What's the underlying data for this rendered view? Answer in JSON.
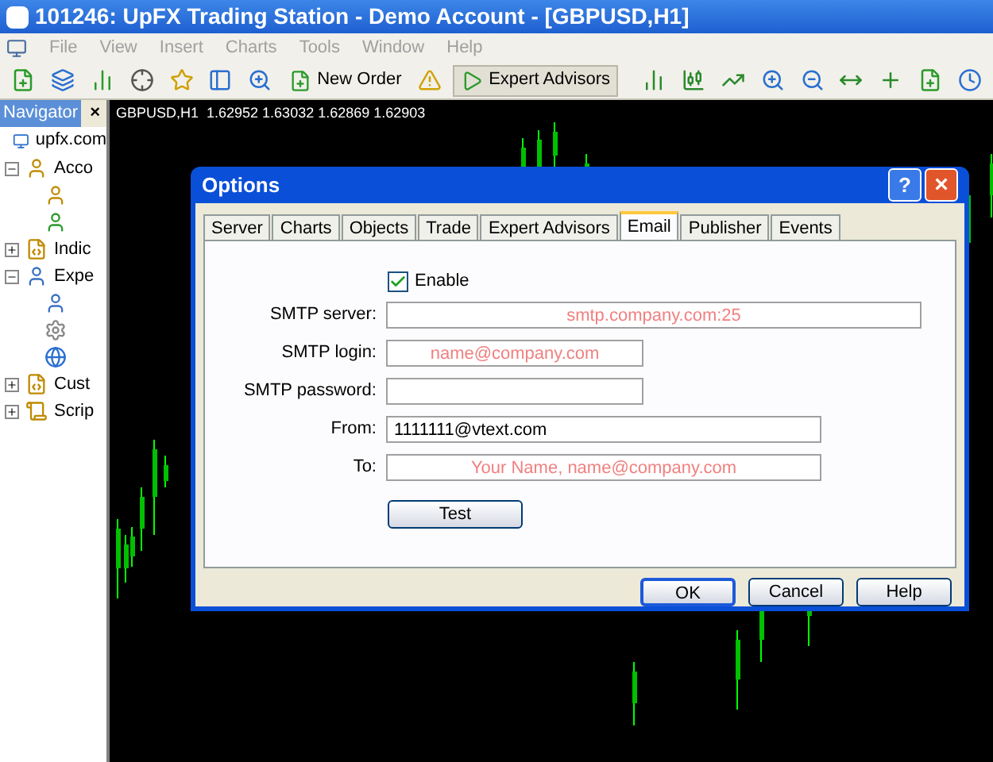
{
  "window": {
    "title": "101246: UpFX Trading Station - Demo Account - [GBPUSD,H1]"
  },
  "menu": [
    {
      "label": "File",
      "disabled": true
    },
    {
      "label": "View",
      "disabled": true
    },
    {
      "label": "Insert",
      "disabled": true
    },
    {
      "label": "Charts",
      "disabled": true
    },
    {
      "label": "Tools",
      "disabled": true
    },
    {
      "label": "Window",
      "disabled": true
    },
    {
      "label": "Help",
      "disabled": true
    }
  ],
  "toolbar": {
    "new_order": "New Order",
    "expert_advisors": {
      "label": "Expert Advisors",
      "selected": true
    }
  },
  "navigator": {
    "title": "Navigator",
    "close": "×",
    "root": "upfx.com",
    "items": [
      {
        "label": "Acco",
        "kind": "accounts",
        "expanded": true,
        "children": [
          {
            "kind": "account"
          },
          {
            "kind": "account-green"
          }
        ]
      },
      {
        "label": "Indic",
        "kind": "indicators",
        "expanded": false
      },
      {
        "label": "Expe",
        "kind": "experts",
        "expanded": true,
        "children": [
          {
            "kind": "expert"
          },
          {
            "kind": "gears"
          },
          {
            "kind": "globe"
          }
        ]
      },
      {
        "label": "Cust",
        "kind": "custom",
        "expanded": false
      },
      {
        "label": "Scrip",
        "kind": "scripts",
        "expanded": false
      }
    ]
  },
  "chart": {
    "header": "GBPUSD,H1  1.62952 1.63032 1.62869 1.62903"
  },
  "dialog": {
    "title": "Options",
    "help": "?",
    "close": "×",
    "tabs": [
      {
        "label": "Server",
        "selected": false
      },
      {
        "label": "Charts",
        "selected": false
      },
      {
        "label": "Objects",
        "selected": false
      },
      {
        "label": "Trade",
        "selected": false
      },
      {
        "label": "Expert Advisors",
        "selected": false
      },
      {
        "label": "Email",
        "selected": true
      },
      {
        "label": "Publisher",
        "selected": false
      },
      {
        "label": "Events",
        "selected": false
      }
    ],
    "enable": {
      "label": "Enable",
      "checked": true
    },
    "fields": [
      {
        "label": "SMTP server:",
        "placeholder": "smtp.company.com:25"
      },
      {
        "label": "SMTP login:",
        "placeholder": "name@company.com"
      },
      {
        "label": "SMTP password:"
      },
      {
        "label": "From:",
        "value": "1111111@vtext.com"
      },
      {
        "label": "To:",
        "placeholder": "Your Name, name@company.com"
      }
    ],
    "test": "Test",
    "buttons": [
      {
        "label": "OK",
        "selected": true
      },
      {
        "label": "Cancel",
        "selected": false
      },
      {
        "label": "Help",
        "selected": false
      }
    ]
  }
}
